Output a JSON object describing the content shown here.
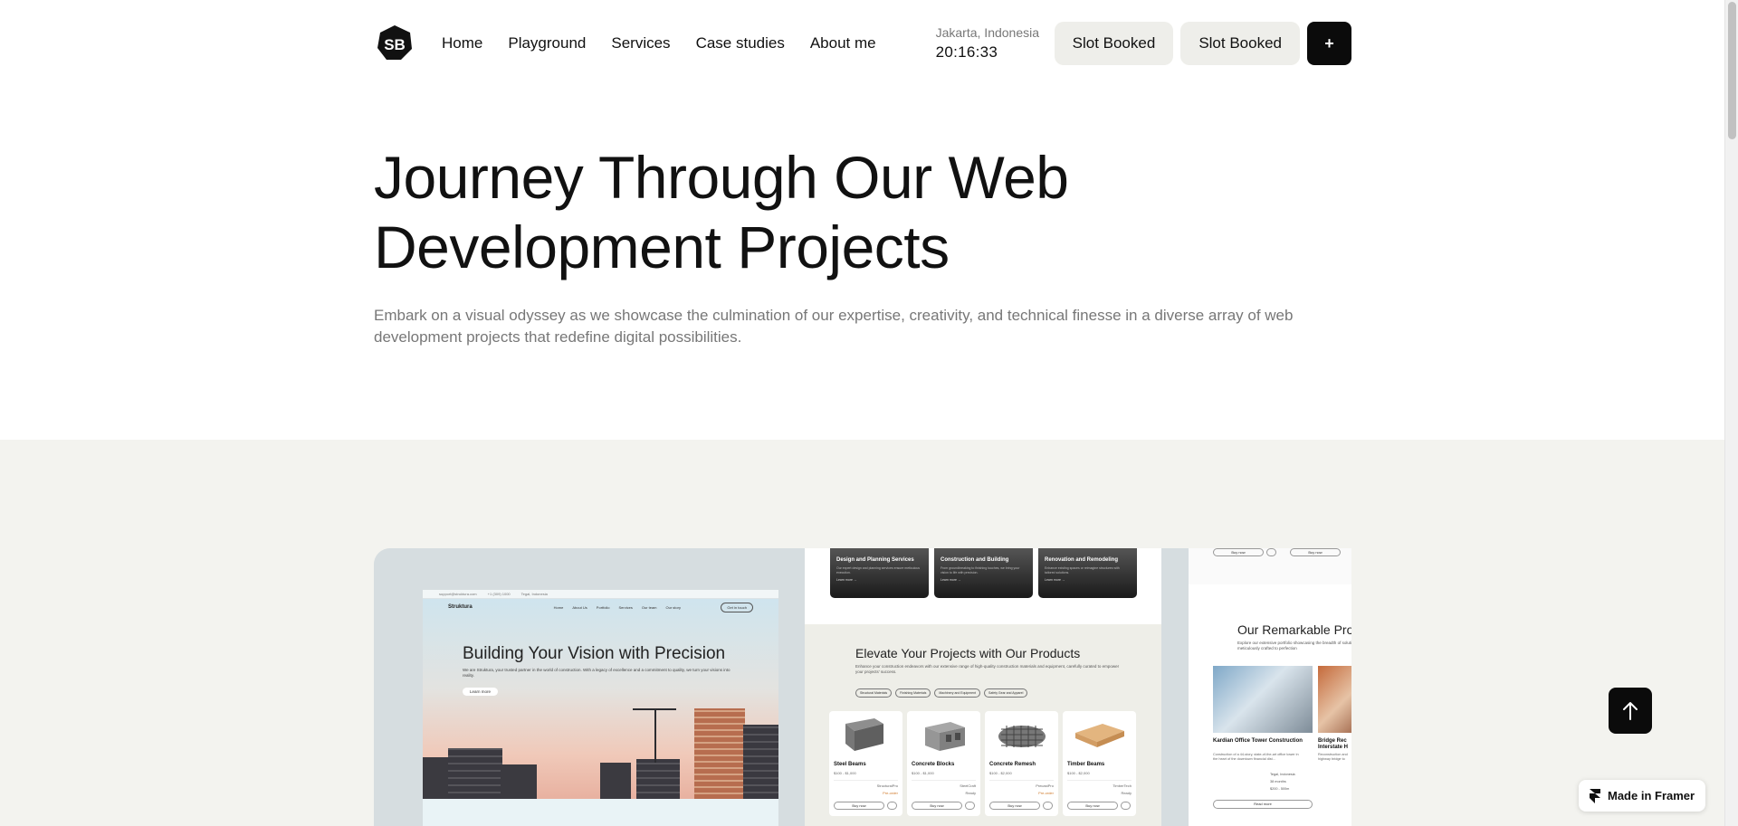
{
  "nav": {
    "logo_text": "SB",
    "links": [
      "Home",
      "Playground",
      "Services",
      "Case studies",
      "About me"
    ],
    "location": "Jakarta, Indonesia",
    "time": "20:16:33",
    "slot_buttons": [
      "Slot Booked",
      "Slot Booked"
    ],
    "plus_label": "+"
  },
  "hero": {
    "title": "Journey Through Our Web Development Projects",
    "description": "Embark on a visual odyssey as we showcase the culmination of our expertise, creativity, and technical finesse in a diverse array of web development projects that redefine digital possibilities."
  },
  "showcase": {
    "card1": {
      "topbar": [
        "support@struktura.com",
        "+1 (309) 1000",
        "Tegal, Indonesia"
      ],
      "brand": "Struktura",
      "nav": [
        "Home",
        "About Us",
        "Portfolio",
        "Services",
        "Our team",
        "Our story"
      ],
      "cta": "Get in touch",
      "heading": "Building Your Vision with Precision",
      "text": "We are Struktura, your trusted partner in the world of construction. With a legacy of excellence and a commitment to quality, we turn your visions into reality.",
      "button": "Learn more"
    },
    "card2": {
      "services": [
        {
          "title": "Design and Planning Services",
          "desc": "Our expert design and planning services ensure meticulous execution.",
          "link": "Learn more →"
        },
        {
          "title": "Construction and Building",
          "desc": "From groundbreaking to finishing touches, we bring your vision to life with precision.",
          "link": "Learn more →"
        },
        {
          "title": "Renovation and Remodeling",
          "desc": "Enhance existing spaces or reimagine structures with tailored solutions.",
          "link": "Learn more →"
        }
      ],
      "title": "Elevate Your Projects with Our Products",
      "subtitle": "Enhance your construction endeavors with our extensive range of high-quality construction materials and equipment, carefully curated to empower your projects' success.",
      "chips": [
        "Structural Materials",
        "Finishing Materials",
        "Machinery and Equipment",
        "Safety Gear and Apparel"
      ],
      "products": [
        {
          "name": "Steel Beams",
          "price": "$100 - $1,000",
          "brand": "StructuralPro",
          "status": "Pre-order"
        },
        {
          "name": "Concrete Blocks",
          "price": "$100 - $1,000",
          "brand": "SteelCraft",
          "status": "Ready"
        },
        {
          "name": "Concrete Remesh",
          "price": "$100 - $2,000",
          "brand": "PrecastPro",
          "status": "Pre-order"
        },
        {
          "name": "Timber Beams",
          "price": "$100 - $2,000",
          "brand": "TimberTech",
          "status": "Ready"
        }
      ],
      "buy_label": "Buy now"
    },
    "card4": {
      "buy_label": "Buy now",
      "title": "Our Remarkable Pro",
      "subtitle": "Explore our extensive portfolio showcasing the breadth of solutions, all meticulously crafted to perfection",
      "projects": [
        {
          "name": "Kardian Office Tower Construction",
          "desc": "Construction of a 44-story, state-of-the-art office tower in the heart of the downtown financial dist...",
          "location": "Tegal, Indonesia",
          "duration": "38 months",
          "budget": "$200 - 500m"
        },
        {
          "name": "Bridge Rec Interstate H",
          "desc": "Reconstruction and highway bridge to"
        }
      ],
      "read_more": "Read more"
    }
  },
  "floating": {
    "framer_label": "Made in Framer"
  }
}
